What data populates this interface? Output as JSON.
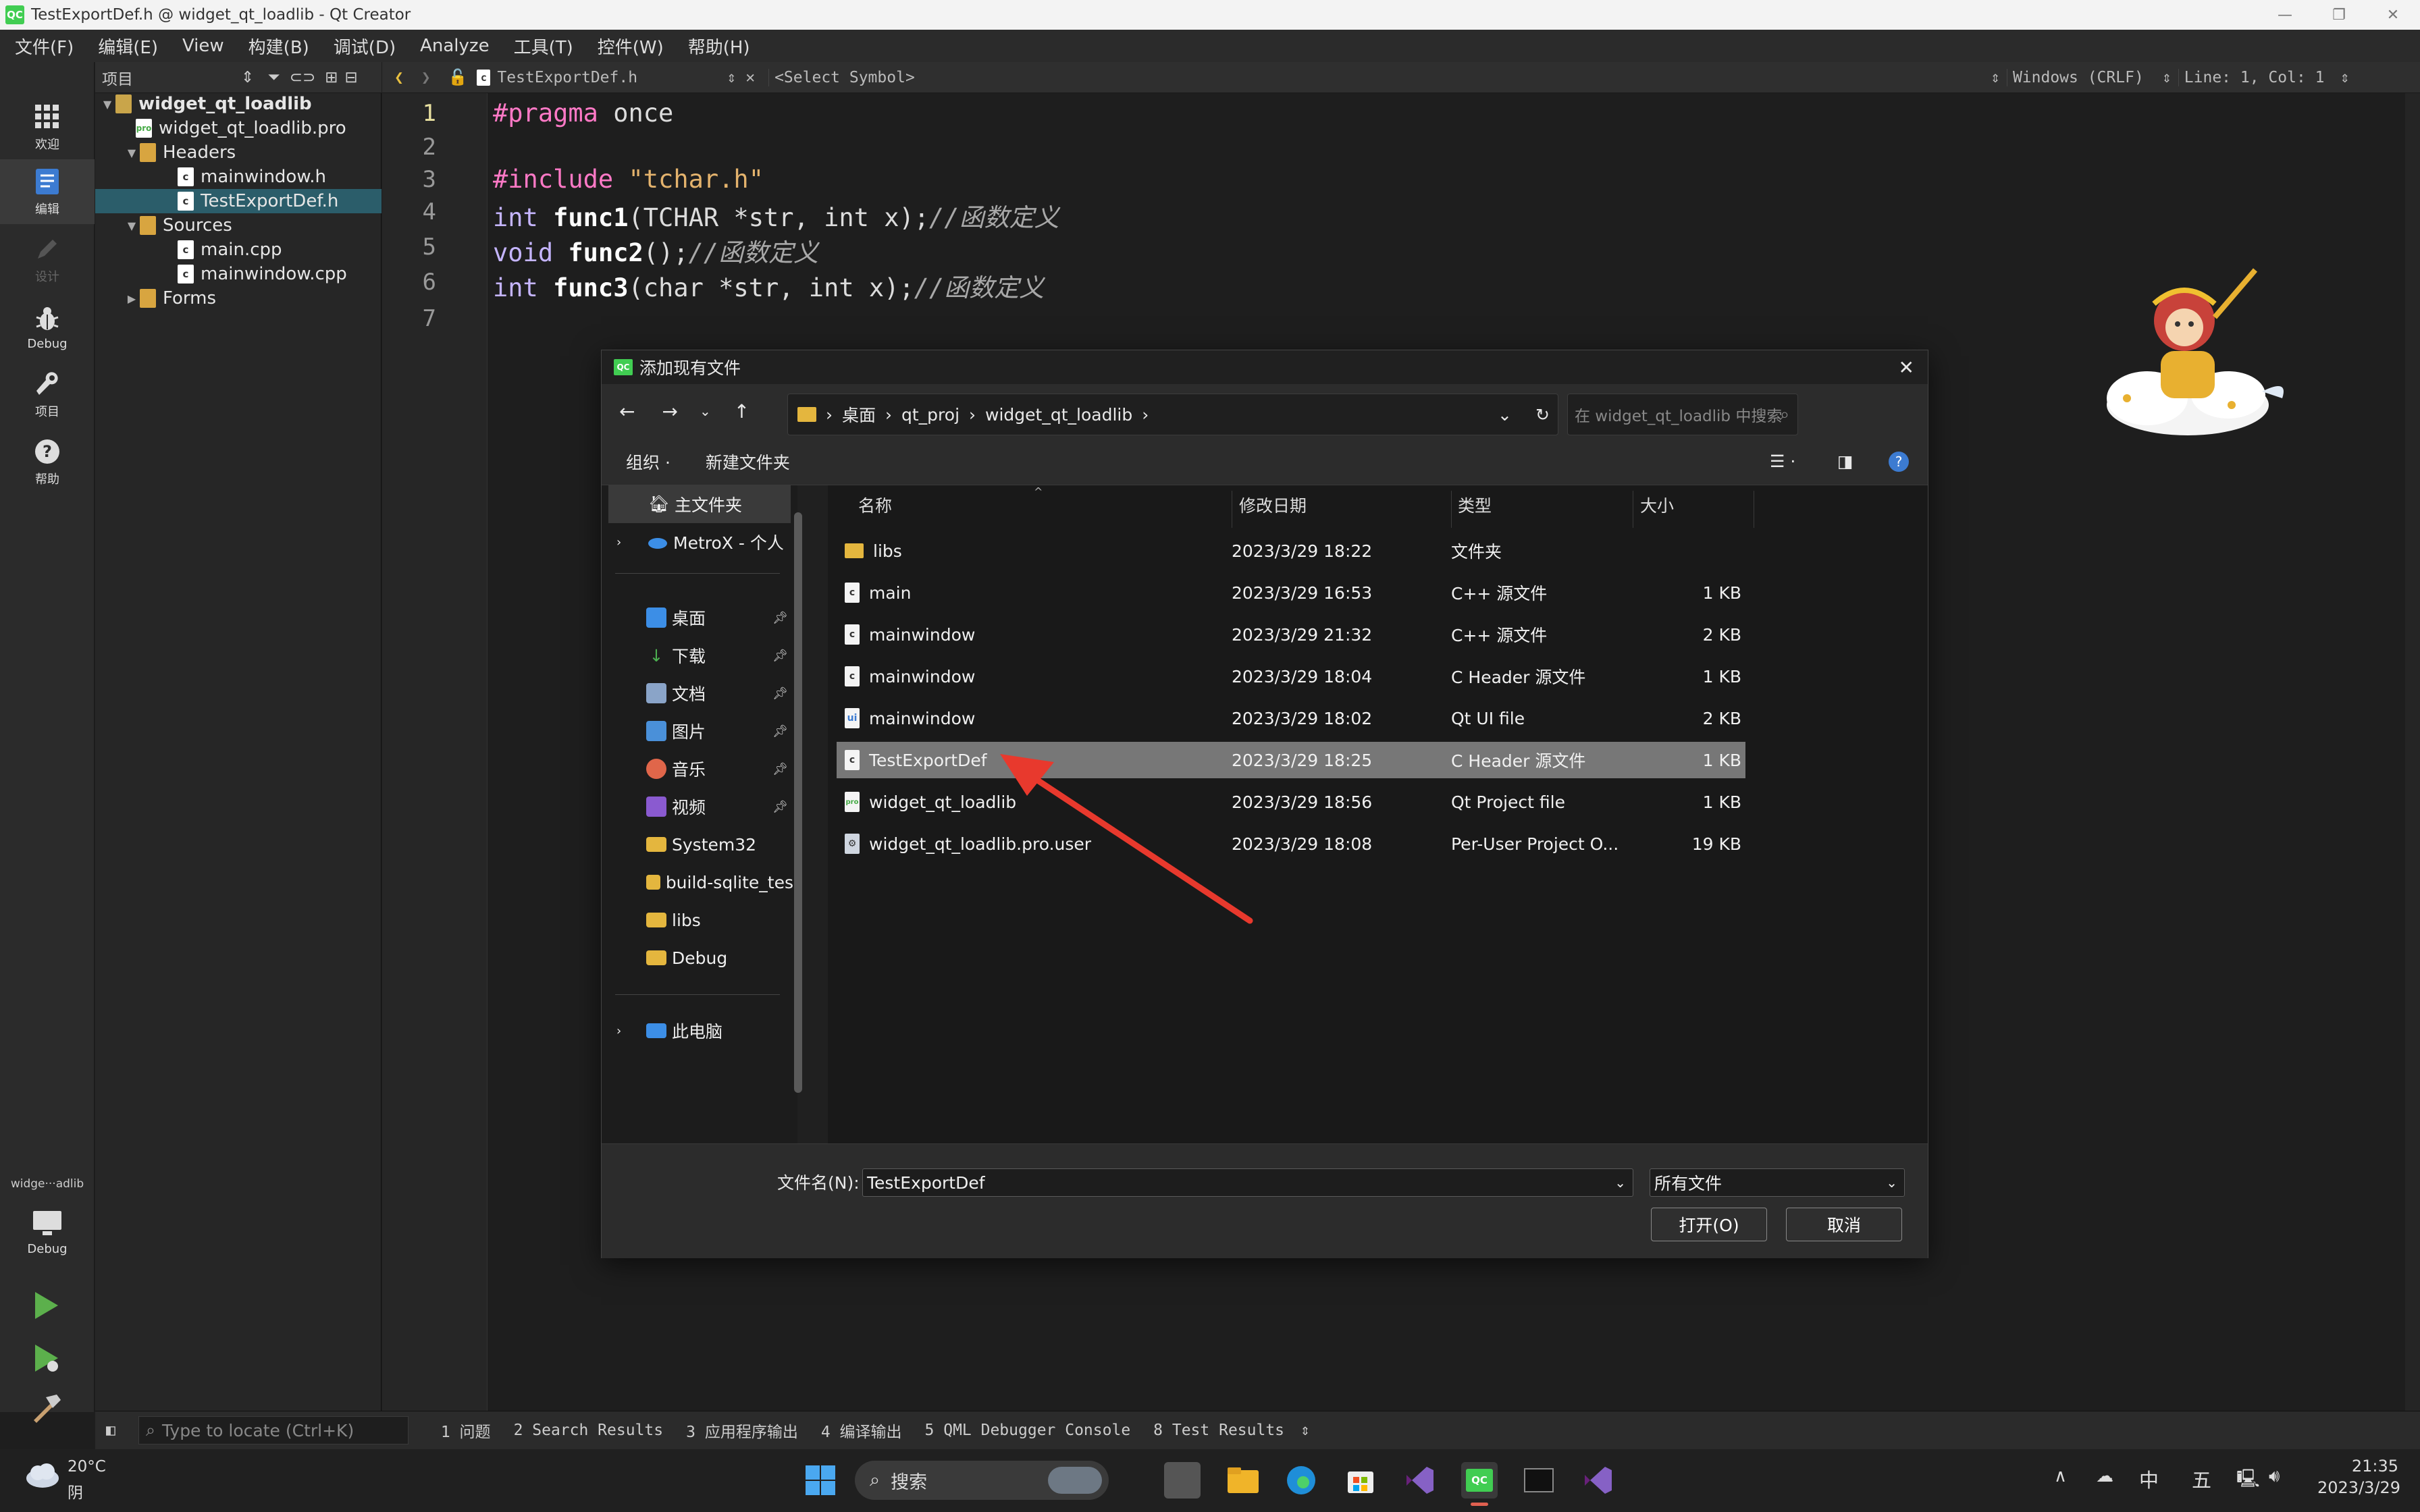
{
  "window": {
    "title": "TestExportDef.h @ widget_qt_loadlib - Qt Creator",
    "logo": "QC"
  },
  "menu": [
    "文件(F)",
    "编辑(E)",
    "View",
    "构建(B)",
    "调试(D)",
    "Analyze",
    "工具(T)",
    "控件(W)",
    "帮助(H)"
  ],
  "modes": {
    "welcome": "欢迎",
    "edit": "编辑",
    "design": "设计",
    "debug": "Debug",
    "projects": "项目",
    "help": "帮助",
    "target_name": "widge···adlib",
    "target_mode": "Debug"
  },
  "project_pane": {
    "title": "项目"
  },
  "tree": {
    "project": "widget_qt_loadlib",
    "pro_file": "widget_qt_loadlib.pro",
    "headers": "Headers",
    "h1": "mainwindow.h",
    "h2": "TestExportDef.h",
    "sources": "Sources",
    "s1": "main.cpp",
    "s2": "mainwindow.cpp",
    "forms": "Forms"
  },
  "editor_toolbar": {
    "file": "TestExportDef.h",
    "symbol": "<Select Symbol>",
    "encoding": "Windows (CRLF)",
    "position": "Line: 1, Col: 1"
  },
  "code": {
    "lines": [
      "1",
      "2",
      "3",
      "4",
      "5",
      "6",
      "7"
    ],
    "l1a": "#pragma",
    "l1b": " once",
    "l3a": "#include",
    "l3b": " \"tchar.h\"",
    "l4a": "int ",
    "l4b": "func1",
    "l4c": "(TCHAR *str, int x);",
    "l4d": "//函数定义",
    "l5a": "void ",
    "l5b": "func2",
    "l5c": "();",
    "l5d": "//函数定义",
    "l6a": "int ",
    "l6b": "func3",
    "l6c": "(char *str, int x);",
    "l6d": "//函数定义"
  },
  "dialog": {
    "title": "添加现有文件",
    "breadcrumb": [
      "桌面",
      "qt_proj",
      "widget_qt_loadlib"
    ],
    "search_placeholder": "在 widget_qt_loadlib 中搜索",
    "organize": "组织 ·",
    "new_folder": "新建文件夹",
    "sidebar": {
      "home": "主文件夹",
      "onedrive": "MetroX - 个人",
      "desktop": "桌面",
      "downloads": "下载",
      "documents": "文档",
      "pictures": "图片",
      "music": "音乐",
      "videos": "视频",
      "f1": "System32",
      "f2": "build-sqlite_tes",
      "f3": "libs",
      "f4": "Debug",
      "pc": "此电脑"
    },
    "columns": {
      "name": "名称",
      "date": "修改日期",
      "type": "类型",
      "size": "大小"
    },
    "files": [
      {
        "name": "libs",
        "date": "2023/3/29 18:22",
        "type": "文件夹",
        "size": ""
      },
      {
        "name": "main",
        "date": "2023/3/29 16:53",
        "type": "C++ 源文件",
        "size": "1 KB"
      },
      {
        "name": "mainwindow",
        "date": "2023/3/29 21:32",
        "type": "C++ 源文件",
        "size": "2 KB"
      },
      {
        "name": "mainwindow",
        "date": "2023/3/29 18:04",
        "type": "C Header 源文件",
        "size": "1 KB"
      },
      {
        "name": "mainwindow",
        "date": "2023/3/29 18:02",
        "type": "Qt UI file",
        "size": "2 KB"
      },
      {
        "name": "TestExportDef",
        "date": "2023/3/29 18:25",
        "type": "C Header 源文件",
        "size": "1 KB"
      },
      {
        "name": "widget_qt_loadlib",
        "date": "2023/3/29 18:56",
        "type": "Qt Project file",
        "size": "1 KB"
      },
      {
        "name": "widget_qt_loadlib.pro.user",
        "date": "2023/3/29 18:08",
        "type": "Per-User Project O...",
        "size": "19 KB"
      }
    ],
    "filename_label": "文件名(N):",
    "filename_value": "TestExportDef",
    "filter": "所有文件",
    "open": "打开(O)",
    "cancel": "取消"
  },
  "output_bar": {
    "locate_placeholder": "Type to locate (Ctrl+K)",
    "tabs": [
      "1  问题",
      "2  Search Results",
      "3  应用程序输出",
      "4  编译输出",
      "5  QML Debugger Console",
      "8  Test Results"
    ]
  },
  "taskbar": {
    "temp": "20°C",
    "weather": "阴",
    "search": "搜索",
    "ime": "中",
    "ime2": "五",
    "time": "21:35",
    "date": "2023/3/29"
  },
  "colors": {
    "selection": "#2b5d6a",
    "arrow": "#e8392d",
    "qt_green": "#41cd52"
  }
}
